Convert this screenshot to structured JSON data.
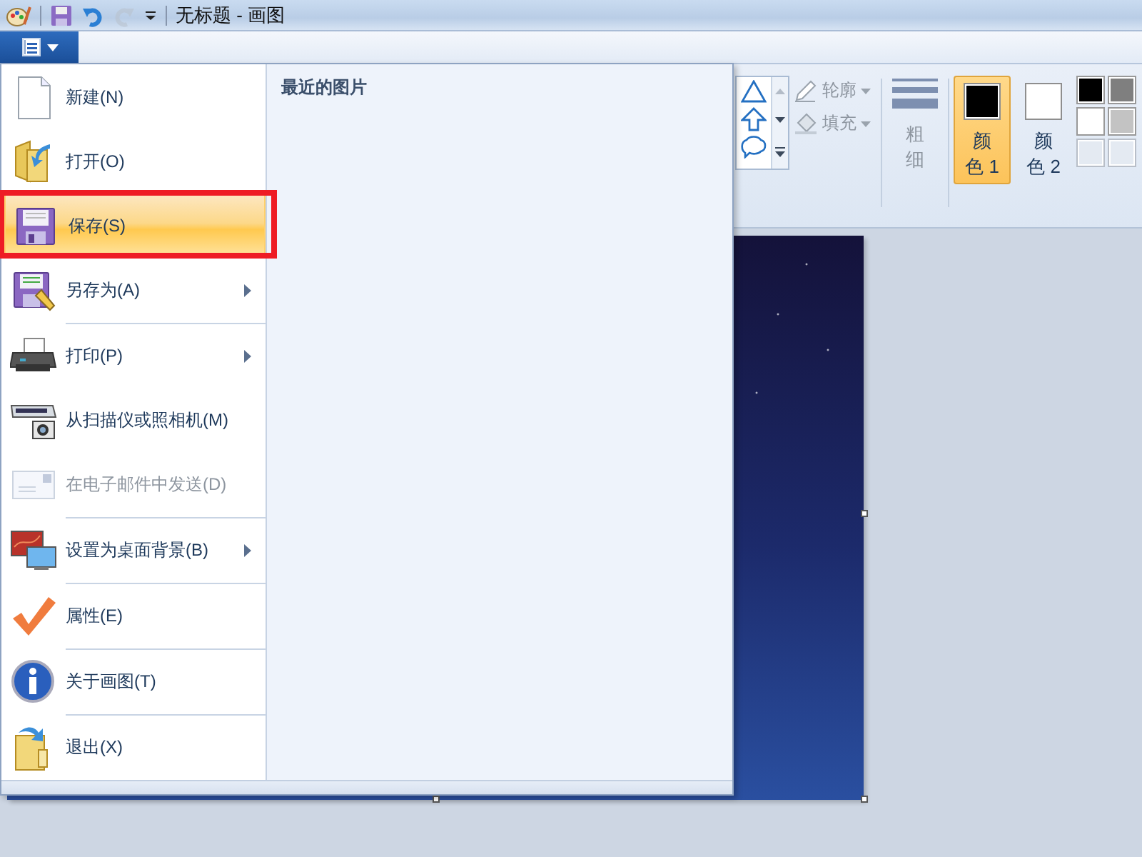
{
  "title_bar": {
    "title": "无标题 - 画图",
    "quick_access": [
      {
        "disabled": false
      },
      {
        "disabled": false
      },
      {
        "disabled": true
      }
    ]
  },
  "menu_button": {
    "expanded": true
  },
  "ribbon": {
    "outline": {
      "label": "轮廓",
      "disabled": true
    },
    "fill": {
      "label": "填充",
      "disabled": true
    },
    "size": {
      "label": "粗细",
      "disabled": true
    },
    "colors": [
      {
        "label": "颜色 1",
        "selected": true,
        "color": "#000000"
      },
      {
        "label": "颜色 2",
        "selected": false,
        "color": "#ffffff"
      }
    ],
    "palette": [
      {
        "color": "#000000"
      },
      {
        "color": "#7f7f7f"
      },
      {
        "color": "#ffffff"
      },
      {
        "color": "#c3c3c3"
      }
    ]
  },
  "app_menu": {
    "items": [
      {
        "label": "新建(N)",
        "disabled": false,
        "selected": false,
        "submenu": false,
        "divider_above": false,
        "annotated": false
      },
      {
        "label": "打开(O)",
        "disabled": false,
        "selected": false,
        "submenu": false,
        "divider_above": false,
        "annotated": false
      },
      {
        "label": "保存(S)",
        "disabled": false,
        "selected": true,
        "submenu": false,
        "divider_above": false,
        "annotated": true
      },
      {
        "label": "另存为(A)",
        "disabled": false,
        "selected": false,
        "submenu": true,
        "divider_above": false,
        "annotated": false
      },
      {
        "label": "打印(P)",
        "disabled": false,
        "selected": false,
        "submenu": true,
        "divider_above": true,
        "annotated": false
      },
      {
        "label": "从扫描仪或照相机(M)",
        "disabled": false,
        "selected": false,
        "submenu": false,
        "divider_above": false,
        "annotated": false
      },
      {
        "label": "在电子邮件中发送(D)",
        "disabled": true,
        "selected": false,
        "submenu": false,
        "divider_above": false,
        "annotated": false
      },
      {
        "label": "设置为桌面背景(B)",
        "disabled": false,
        "selected": false,
        "submenu": true,
        "divider_above": true,
        "annotated": false
      },
      {
        "label": "属性(E)",
        "disabled": false,
        "selected": false,
        "submenu": false,
        "divider_above": true,
        "annotated": false
      },
      {
        "label": "关于画图(T)",
        "disabled": false,
        "selected": false,
        "submenu": false,
        "divider_above": true,
        "annotated": false
      },
      {
        "label": "退出(X)",
        "disabled": false,
        "selected": false,
        "submenu": false,
        "divider_above": true,
        "annotated": false
      }
    ],
    "recent": {
      "heading": "最近的图片"
    }
  }
}
